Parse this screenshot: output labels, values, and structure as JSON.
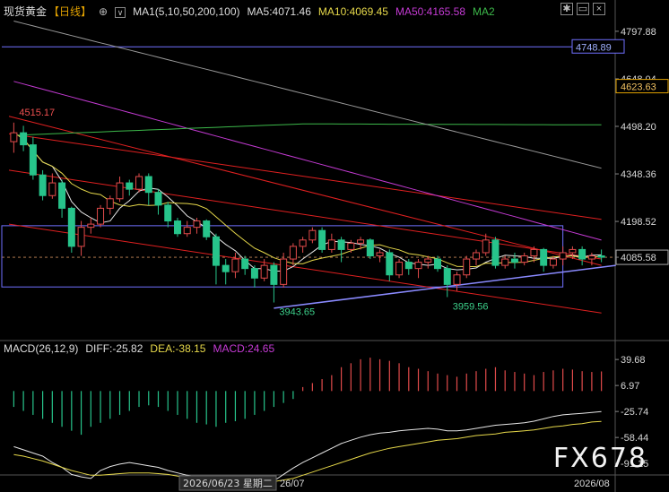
{
  "header": {
    "symbol": "现货黄金",
    "period": "【日线】",
    "ma_config": "MA1(5,10,50,200,100)",
    "ma5": "MA5:4071.46",
    "ma10": "MA10:4069.45",
    "ma50": "MA50:4165.58",
    "ma2": "MA2"
  },
  "macd_header": {
    "config": "MACD(26,12,9)",
    "diff": "DIFF:-25.82",
    "dea": "DEA:-38.15",
    "macd": "MACD:24.65"
  },
  "date_labels": {
    "cursor": "2026/06/23 星期二",
    "mid": "26/07",
    "end": "2026/08"
  },
  "watermark": "FX678",
  "colors": {
    "up": "#e24b4b",
    "down": "#27c48b",
    "ma5": "#e6e6e6",
    "ma10": "#e6d84a",
    "ma50": "#c43ad3",
    "ma100": "#3cb84a",
    "ma200": "#9a9a9a",
    "channel": "#e02020",
    "support": "#8a8aff",
    "box": "#7070ff",
    "current_price_box": "#e0a000"
  },
  "chart_data": {
    "type": "candlestick",
    "price_axis": {
      "range": [
        3840,
        4840
      ],
      "ticks": [
        "4797.88",
        "4648.04",
        "4498.20",
        "4348.36",
        "4198.52",
        "4085.58"
      ],
      "highlight_labels": [
        "4748.89",
        "4623.63"
      ],
      "last_price": "4085.58"
    },
    "annotations": [
      {
        "text": "4515.17",
        "x": 0,
        "y": 4515.17
      },
      {
        "text": "3943.65",
        "x": 27,
        "y": 3943.65
      },
      {
        "text": "3959.56",
        "x": 45,
        "y": 3959.56
      }
    ],
    "candles": [
      [
        4450,
        4478,
        4415,
        4510
      ],
      [
        4478,
        4440,
        4420,
        4500
      ],
      [
        4440,
        4345,
        4330,
        4465
      ],
      [
        4345,
        4280,
        4265,
        4360
      ],
      [
        4280,
        4320,
        4270,
        4350
      ],
      [
        4320,
        4240,
        4210,
        4330
      ],
      [
        4240,
        4120,
        4100,
        4245
      ],
      [
        4120,
        4180,
        4090,
        4200
      ],
      [
        4180,
        4190,
        4160,
        4210
      ],
      [
        4190,
        4240,
        4180,
        4250
      ],
      [
        4240,
        4270,
        4220,
        4280
      ],
      [
        4270,
        4320,
        4260,
        4340
      ],
      [
        4320,
        4300,
        4280,
        4330
      ],
      [
        4300,
        4340,
        4290,
        4350
      ],
      [
        4340,
        4290,
        4250,
        4350
      ],
      [
        4290,
        4250,
        4220,
        4300
      ],
      [
        4250,
        4200,
        4180,
        4260
      ],
      [
        4200,
        4160,
        4150,
        4210
      ],
      [
        4160,
        4180,
        4150,
        4200
      ],
      [
        4180,
        4200,
        4160,
        4210
      ],
      [
        4200,
        4150,
        4140,
        4205
      ],
      [
        4150,
        4060,
        4000,
        4160
      ],
      [
        4060,
        4040,
        4000,
        4080
      ],
      [
        4040,
        4080,
        4020,
        4100
      ],
      [
        4080,
        4050,
        4030,
        4090
      ],
      [
        4050,
        4020,
        3990,
        4060
      ],
      [
        4020,
        4060,
        4010,
        4080
      ],
      [
        4060,
        4000,
        3943,
        4070
      ],
      [
        4000,
        4080,
        3990,
        4100
      ],
      [
        4080,
        4120,
        4060,
        4130
      ],
      [
        4120,
        4140,
        4100,
        4150
      ],
      [
        4140,
        4170,
        4130,
        4180
      ],
      [
        4170,
        4110,
        4100,
        4180
      ],
      [
        4110,
        4140,
        4100,
        4160
      ],
      [
        4140,
        4110,
        4070,
        4150
      ],
      [
        4110,
        4130,
        4100,
        4140
      ],
      [
        4130,
        4140,
        4110,
        4150
      ],
      [
        4140,
        4090,
        4080,
        4145
      ],
      [
        4090,
        4100,
        4070,
        4110
      ],
      [
        4100,
        4030,
        4010,
        4110
      ],
      [
        4030,
        4070,
        4020,
        4080
      ],
      [
        4070,
        4050,
        4030,
        4080
      ],
      [
        4050,
        4070,
        4020,
        4080
      ],
      [
        4070,
        4080,
        4050,
        4090
      ],
      [
        4080,
        4050,
        4040,
        4090
      ],
      [
        4050,
        4000,
        3960,
        4060
      ],
      [
        4000,
        4030,
        3980,
        4040
      ],
      [
        4030,
        4080,
        4020,
        4090
      ],
      [
        4080,
        4100,
        4060,
        4110
      ],
      [
        4100,
        4140,
        4090,
        4160
      ],
      [
        4140,
        4060,
        4050,
        4150
      ],
      [
        4060,
        4080,
        4050,
        4090
      ],
      [
        4080,
        4070,
        4050,
        4100
      ],
      [
        4070,
        4090,
        4060,
        4100
      ],
      [
        4090,
        4110,
        4070,
        4120
      ],
      [
        4110,
        4060,
        4040,
        4115
      ],
      [
        4060,
        4080,
        4050,
        4090
      ],
      [
        4080,
        4100,
        4060,
        4120
      ],
      [
        4100,
        4110,
        4080,
        4120
      ],
      [
        4110,
        4080,
        4060,
        4120
      ],
      [
        4080,
        4090,
        4060,
        4100
      ],
      [
        4090,
        4085.58,
        4070,
        4110
      ]
    ],
    "macd": {
      "axis_ticks": [
        "39.68",
        "6.97",
        "-25.74",
        "-58.44",
        "-91.15"
      ],
      "range": [
        -100,
        50
      ],
      "histogram": [
        -20,
        -25,
        -30,
        -35,
        -40,
        -45,
        -50,
        -55,
        -45,
        -40,
        -35,
        -30,
        -25,
        -20,
        -18,
        -20,
        -25,
        -30,
        -35,
        -40,
        -42,
        -45,
        -40,
        -38,
        -35,
        -30,
        -25,
        -20,
        -15,
        -10,
        5,
        10,
        15,
        20,
        30,
        35,
        40,
        42,
        40,
        38,
        35,
        30,
        28,
        25,
        22,
        20,
        18,
        22,
        25,
        28,
        30,
        26,
        24,
        22,
        20,
        24,
        26,
        28,
        27,
        25,
        24,
        24.65
      ],
      "diff": [
        -70,
        -74,
        -78,
        -82,
        -90,
        -96,
        -105,
        -108,
        -110,
        -100,
        -95,
        -92,
        -90,
        -92,
        -94,
        -96,
        -100,
        -103,
        -106,
        -108,
        -110,
        -112,
        -114,
        -115,
        -115,
        -116,
        -115,
        -113,
        -105,
        -97,
        -90,
        -84,
        -78,
        -72,
        -66,
        -62,
        -58,
        -55,
        -53,
        -52,
        -50,
        -49,
        -48,
        -47,
        -48,
        -50,
        -50,
        -49,
        -47,
        -45,
        -43,
        -42,
        -41,
        -40,
        -38,
        -35,
        -32,
        -30,
        -29,
        -28,
        -27,
        -25.82
      ],
      "dea": [
        -80,
        -82,
        -85,
        -88,
        -92,
        -96,
        -100,
        -103,
        -106,
        -106,
        -105,
        -104,
        -103,
        -103,
        -103,
        -104,
        -105,
        -107,
        -108,
        -109,
        -110,
        -111,
        -112,
        -113,
        -114,
        -114,
        -114,
        -114,
        -112,
        -110,
        -106,
        -102,
        -98,
        -94,
        -90,
        -86,
        -82,
        -78,
        -75,
        -72,
        -70,
        -68,
        -66,
        -64,
        -62,
        -61,
        -60,
        -58,
        -56,
        -55,
        -54,
        -52,
        -51,
        -50,
        -49,
        -47,
        -45,
        -44,
        -42,
        -41,
        -39,
        -38.15
      ]
    },
    "grid": false
  }
}
